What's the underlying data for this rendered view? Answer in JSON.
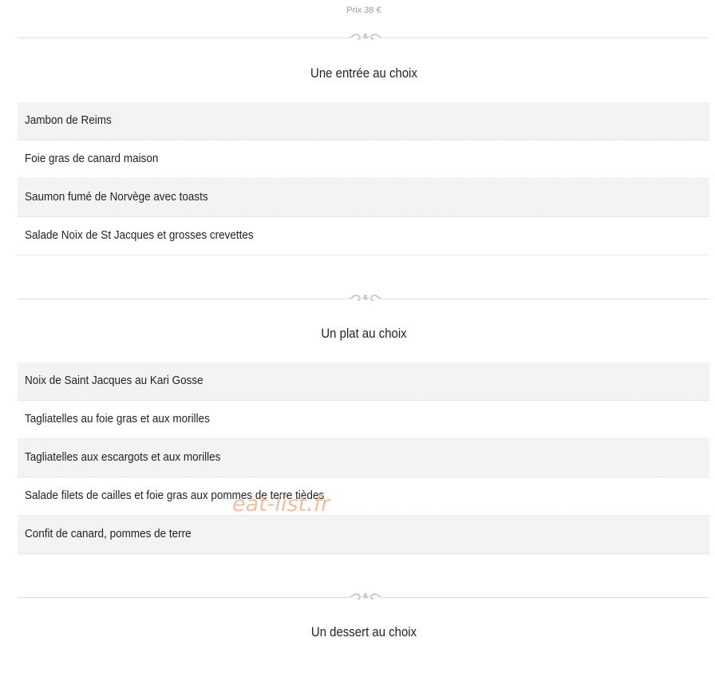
{
  "price": "Prix 38 €",
  "sections": [
    {
      "title": "Une entrée au choix",
      "items": [
        "Jambon de Reims",
        "Foie gras de canard maison",
        "Saumon fumé de Norvège avec toasts",
        "Salade Noix de St Jacques et grosses crevettes"
      ]
    },
    {
      "title": "Un plat au choix",
      "items": [
        "Noix de Saint Jacques au Kari Gosse",
        "Tagliatelles au foie gras et aux morilles",
        "Tagliatelles aux escargots et aux morilles",
        "Salade filets de cailles et foie gras aux pommes de terre tièdes",
        "Confit de canard, pommes de terre"
      ]
    },
    {
      "title": "Un dessert au choix",
      "items": []
    }
  ],
  "watermark": "eat-list.fr",
  "ornament_icon": "flourish-ornament-icon"
}
